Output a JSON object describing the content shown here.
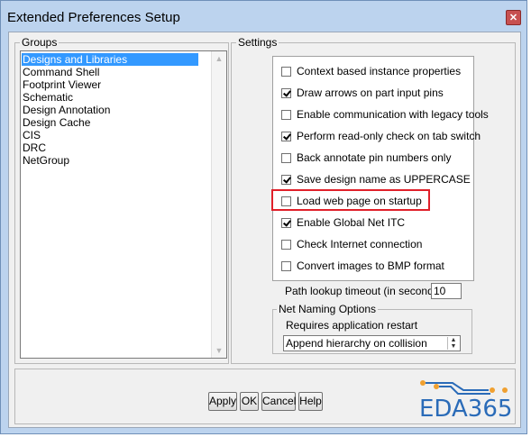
{
  "window": {
    "title": "Extended Preferences Setup",
    "close_label": "✕"
  },
  "groups": {
    "label": "Groups",
    "items": [
      {
        "label": "Designs and Libraries",
        "selected": true
      },
      {
        "label": "Command Shell",
        "selected": false
      },
      {
        "label": "Footprint Viewer",
        "selected": false
      },
      {
        "label": "Schematic",
        "selected": false
      },
      {
        "label": "Design Annotation",
        "selected": false
      },
      {
        "label": "Design Cache",
        "selected": false
      },
      {
        "label": "CIS",
        "selected": false
      },
      {
        "label": "DRC",
        "selected": false
      },
      {
        "label": "NetGroup",
        "selected": false
      }
    ]
  },
  "settings": {
    "label": "Settings",
    "options": [
      {
        "label": "Context based instance properties",
        "checked": false
      },
      {
        "label": "Draw arrows on part input pins",
        "checked": true
      },
      {
        "label": "Enable communication with legacy tools",
        "checked": false
      },
      {
        "label": "Perform read-only check on tab switch",
        "checked": true
      },
      {
        "label": "Back annotate pin numbers only",
        "checked": false
      },
      {
        "label": "Save design name as UPPERCASE",
        "checked": true
      },
      {
        "label": "Load web page on startup",
        "checked": false
      },
      {
        "label": "Enable Global Net ITC",
        "checked": true
      },
      {
        "label": "Check Internet connection",
        "checked": false
      },
      {
        "label": "Convert images to BMP format",
        "checked": false
      }
    ],
    "path_timeout_label": "Path lookup timeout (in seconds)",
    "path_timeout_value": "10",
    "net_naming": {
      "label": "Net Naming Options",
      "note": "Requires application restart",
      "selected_option": "Append hierarchy on collision"
    }
  },
  "buttons": {
    "apply": "Apply",
    "ok": "OK",
    "cancel": "Cancel",
    "help": "Help"
  },
  "logo": {
    "text": "EDA365"
  },
  "colors": {
    "selection": "#3399ff",
    "highlight_box": "#e0202a",
    "logo": "#2a6bb8",
    "logo_accent": "#f0a030"
  }
}
